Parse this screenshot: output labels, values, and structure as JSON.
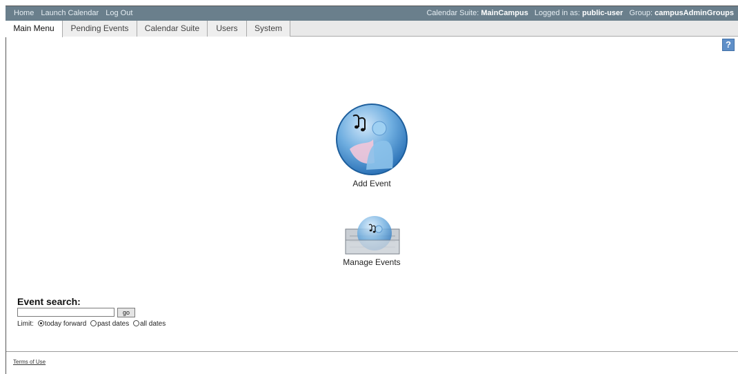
{
  "topbar": {
    "links": [
      "Home",
      "Launch Calendar",
      "Log Out"
    ],
    "suite_label": "Calendar Suite:",
    "suite_value": "MainCampus",
    "user_label": "Logged in as:",
    "user_value": "public-user",
    "group_label": "Group:",
    "group_value": "campusAdminGroups"
  },
  "tabs": [
    "Main Menu",
    "Pending Events",
    "Calendar Suite",
    "Users",
    "System"
  ],
  "help": {
    "label": "?"
  },
  "actions": {
    "add_event": "Add Event",
    "manage_events": "Manage Events"
  },
  "search": {
    "title": "Event search:",
    "input_value": "",
    "go_label": "go",
    "limit_label": "Limit:",
    "options": [
      "today forward",
      "past dates",
      "all dates"
    ],
    "selected": "today forward"
  },
  "footer": {
    "terms": "Terms of Use"
  },
  "colors": {
    "topbar": "#6a7f8c",
    "accent": "#5f8fc8"
  }
}
